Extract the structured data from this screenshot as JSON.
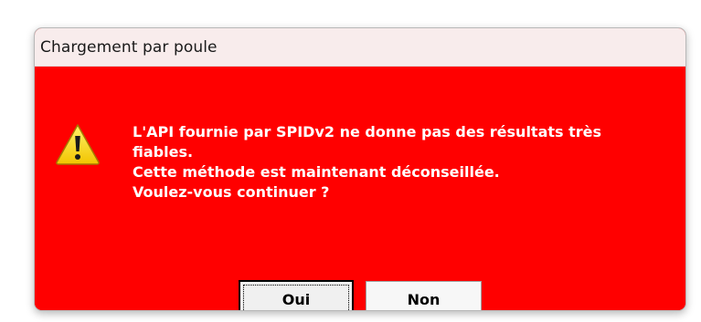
{
  "dialog": {
    "title": "Chargement par poule",
    "background_color": "#ff0000",
    "icon": "warning-icon",
    "message_lines": [
      "L'API fournie par SPIDv2 ne donne pas des résultats très",
      "fiables.",
      "Cette méthode est maintenant déconseillée.",
      "Voulez-vous continuer ?"
    ],
    "buttons": {
      "yes_label": "Oui",
      "no_label": "Non"
    }
  }
}
